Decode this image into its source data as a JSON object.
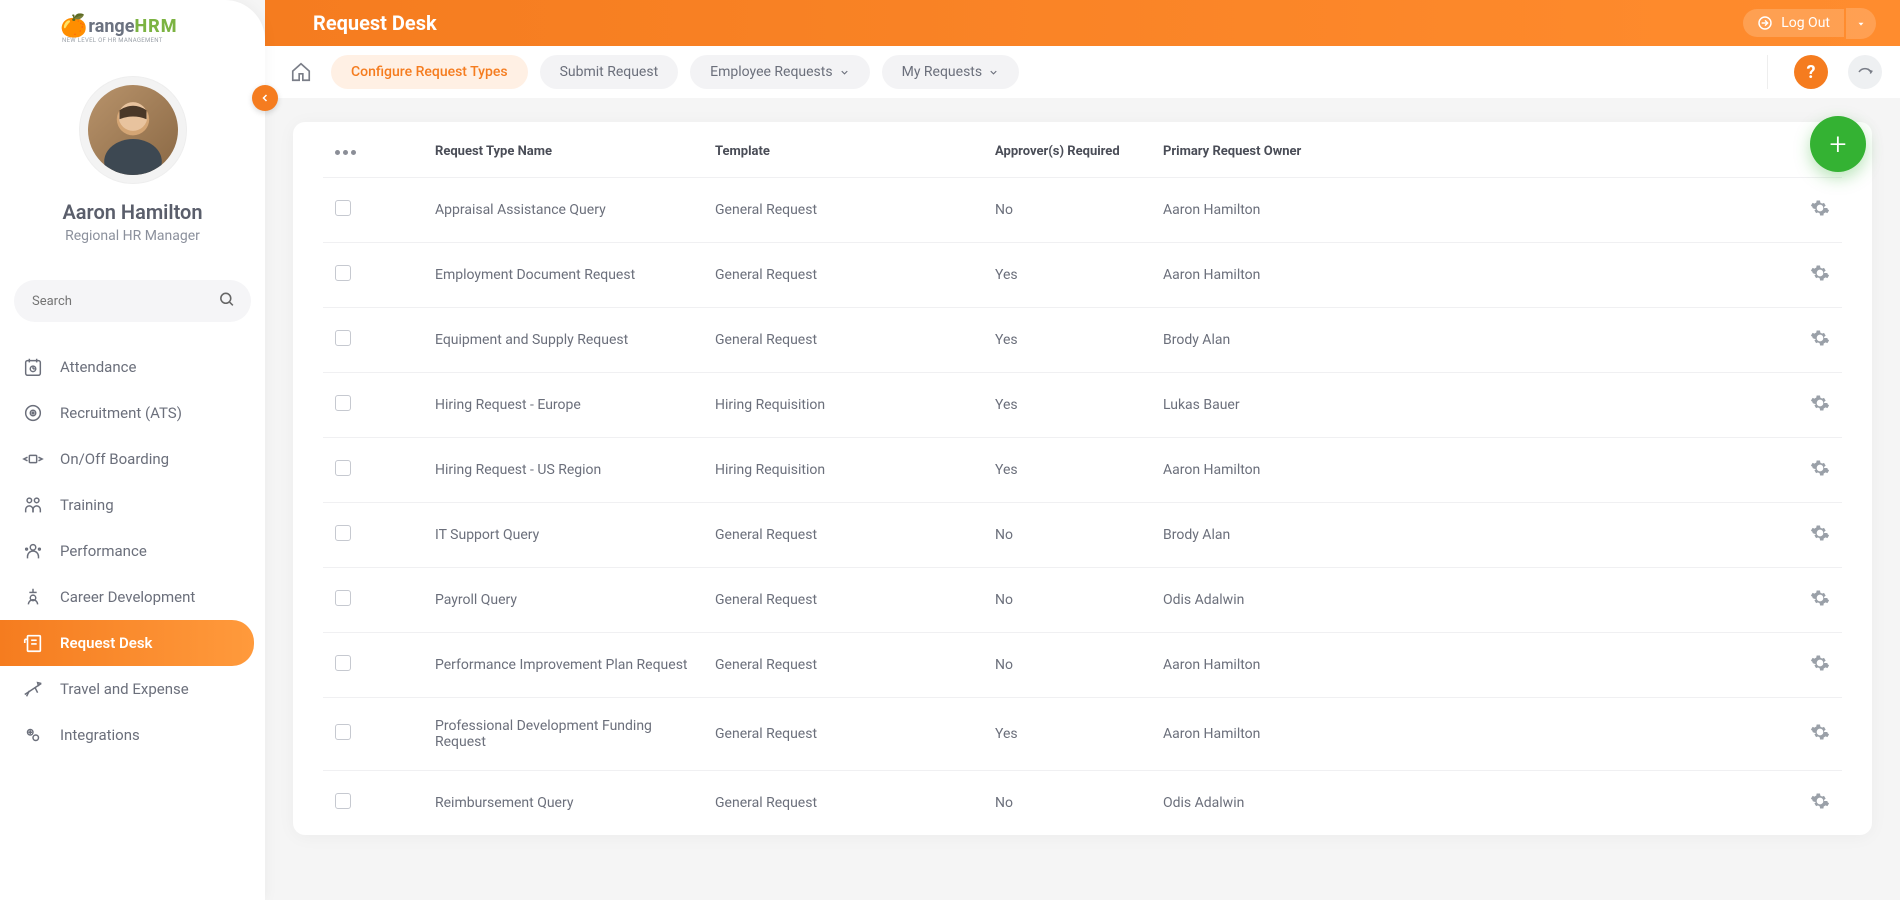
{
  "logo": {
    "prefix": "range",
    "suffix": "HRM",
    "tagline": "NEW LEVEL OF HR MANAGEMENT"
  },
  "profile": {
    "name": "Aaron Hamilton",
    "role": "Regional HR Manager"
  },
  "search": {
    "placeholder": "Search"
  },
  "nav": [
    {
      "label": "Attendance"
    },
    {
      "label": "Recruitment (ATS)"
    },
    {
      "label": "On/Off Boarding"
    },
    {
      "label": "Training"
    },
    {
      "label": "Performance"
    },
    {
      "label": "Career Development"
    },
    {
      "label": "Request Desk",
      "active": true
    },
    {
      "label": "Travel and Expense"
    },
    {
      "label": "Integrations"
    }
  ],
  "header": {
    "title": "Request Desk",
    "logout": "Log Out"
  },
  "tabs": [
    {
      "label": "Configure Request Types",
      "active": true
    },
    {
      "label": "Submit Request"
    },
    {
      "label": "Employee Requests",
      "caret": true
    },
    {
      "label": "My Requests",
      "caret": true
    }
  ],
  "table": {
    "columns": [
      "Request Type Name",
      "Template",
      "Approver(s) Required",
      "Primary Request Owner"
    ],
    "rows": [
      {
        "name": "Appraisal Assistance Query",
        "template": "General Request",
        "approver": "No",
        "owner": "Aaron Hamilton"
      },
      {
        "name": "Employment Document Request",
        "template": "General Request",
        "approver": "Yes",
        "owner": "Aaron Hamilton"
      },
      {
        "name": "Equipment and Supply Request",
        "template": "General Request",
        "approver": "Yes",
        "owner": "Brody Alan"
      },
      {
        "name": "Hiring Request - Europe",
        "template": "Hiring Requisition",
        "approver": "Yes",
        "owner": "Lukas Bauer"
      },
      {
        "name": "Hiring Request - US Region",
        "template": "Hiring Requisition",
        "approver": "Yes",
        "owner": "Aaron Hamilton"
      },
      {
        "name": "IT Support Query",
        "template": "General Request",
        "approver": "No",
        "owner": "Brody Alan"
      },
      {
        "name": "Payroll Query",
        "template": "General Request",
        "approver": "No",
        "owner": "Odis Adalwin"
      },
      {
        "name": "Performance Improvement Plan Request",
        "template": "General Request",
        "approver": "No",
        "owner": "Aaron Hamilton"
      },
      {
        "name": "Professional Development Funding Request",
        "template": "General Request",
        "approver": "Yes",
        "owner": "Aaron Hamilton"
      },
      {
        "name": "Reimbursement Query",
        "template": "General Request",
        "approver": "No",
        "owner": "Odis Adalwin"
      }
    ]
  }
}
